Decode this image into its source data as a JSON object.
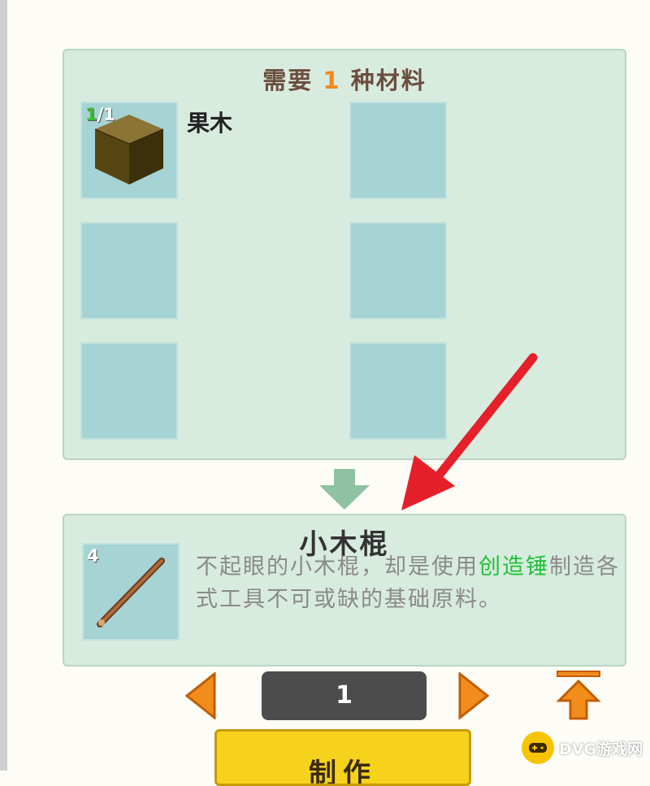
{
  "recipe": {
    "header_prefix": "需要",
    "header_count": "1",
    "header_suffix": "种材料",
    "materials": [
      {
        "qty_have": "1",
        "qty_need": "/1",
        "name": "果木"
      }
    ]
  },
  "result": {
    "name": "小木棍",
    "count": "4",
    "desc_part1": "不起眼的小木棍，却是使用",
    "desc_highlight": "创造锤",
    "desc_part2": "制造各式工具不可或缺的基础原料。"
  },
  "controls": {
    "quantity": "1",
    "craft_label": "制作"
  },
  "watermark": {
    "text": "DVG游戏网"
  },
  "colors": {
    "panel_bg": "#d8ebdf",
    "slot_bg": "#a6d3d3",
    "highlight_orange": "#f08a1c",
    "highlight_green": "#22c038",
    "craft_button": "#f6d21c",
    "annotation_arrow": "#e5202a"
  }
}
